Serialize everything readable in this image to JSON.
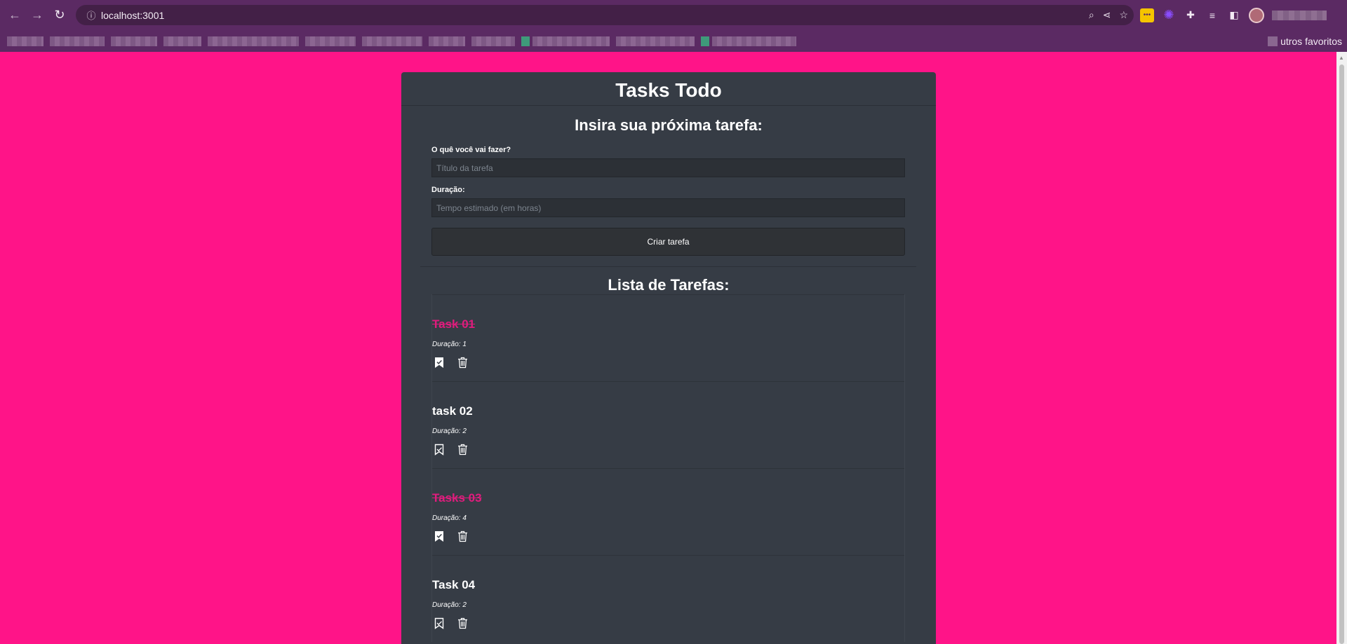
{
  "browser": {
    "url": "localhost:3001",
    "other_bookmarks_label": "utros favoritos"
  },
  "app": {
    "title": "Tasks Todo",
    "form": {
      "heading": "Insira sua próxima tarefa:",
      "title_label": "O quê você vai fazer?",
      "title_placeholder": "Título da tarefa",
      "duration_label": "Duração:",
      "duration_placeholder": "Tempo estimado (em horas)",
      "submit_label": "Criar tarefa"
    },
    "list": {
      "heading": "Lista de Tarefas:",
      "duration_prefix": "Duração:",
      "tasks": [
        {
          "title": "Task 01",
          "duration": "1",
          "completed": true
        },
        {
          "title": "task 02",
          "duration": "2",
          "completed": false
        },
        {
          "title": "Tasks 03",
          "duration": "4",
          "completed": true
        },
        {
          "title": "Task 04",
          "duration": "2",
          "completed": false
        }
      ]
    }
  },
  "icons": {
    "bookmark": "bookmark-icon",
    "trash": "trash-icon"
  },
  "colors": {
    "page_background": "#ff1488",
    "card_background": "#363c45",
    "completed_title": "#e01c7d",
    "browser_chrome": "#5b2a63"
  }
}
